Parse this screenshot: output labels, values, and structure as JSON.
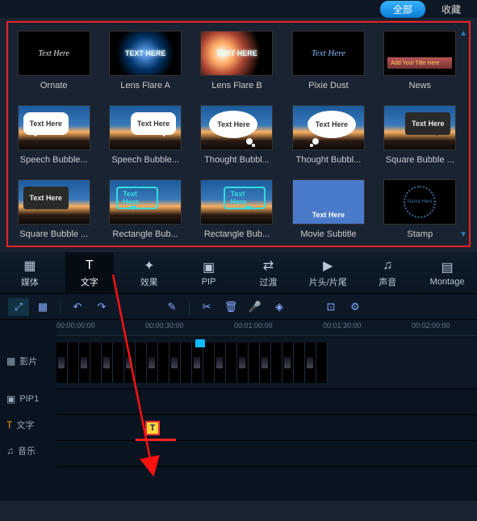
{
  "header": {
    "all_btn": "全部",
    "fav_link": "收藏"
  },
  "gallery": [
    {
      "label": "Ornate",
      "text": "Text Here",
      "cls": "t-dark t-ornate"
    },
    {
      "label": "Lens Flare A",
      "text": "TEXT HERE",
      "cls": "t-flare"
    },
    {
      "label": "Lens Flare B",
      "text": "TEXT HERE",
      "cls": "t-flare t-flareb"
    },
    {
      "label": "Pixie Dust",
      "text": "Text Here",
      "cls": "t-pixie"
    },
    {
      "label": "News",
      "text": "Add Your Title Here",
      "cls": "t-news",
      "news": true
    },
    {
      "label": "Speech Bubble...",
      "text": "Text Here",
      "cls": "t-sunset",
      "bubble": "b-spl"
    },
    {
      "label": "Speech Bubble...",
      "text": "Text Here",
      "cls": "t-sunset",
      "bubble": "b-spr"
    },
    {
      "label": "Thought Bubbl...",
      "text": "Text Here",
      "cls": "t-sunset",
      "bubble": "b-thl"
    },
    {
      "label": "Thought Bubbl...",
      "text": "Text Here",
      "cls": "t-sunset",
      "bubble": "b-thr"
    },
    {
      "label": "Square Bubble ...",
      "text": "Text Here",
      "cls": "t-sunset",
      "bubble": "b-sqr"
    },
    {
      "label": "Square Bubble ...",
      "text": "Text Here",
      "cls": "t-sunset",
      "bubble": "b-sql"
    },
    {
      "label": "Rectangle Bub...",
      "text": "Text Here",
      "cls": "t-sunset",
      "bubble": "b-rectl"
    },
    {
      "label": "Rectangle Bub...",
      "text": "Text Here",
      "cls": "t-sunset",
      "bubble": "b-rectr"
    },
    {
      "label": "Movie Subtitle",
      "text": "Text Here",
      "cls": "t-movsub",
      "movsub": true
    },
    {
      "label": "Stamp",
      "text": "Name Here",
      "cls": "t-stamp",
      "stamp": true
    }
  ],
  "tabs": [
    {
      "key": "media",
      "label": "媒体",
      "icon": "▦"
    },
    {
      "key": "text",
      "label": "文字",
      "icon": "T",
      "active": true
    },
    {
      "key": "effect",
      "label": "效果",
      "icon": "✦"
    },
    {
      "key": "pip",
      "label": "PIP",
      "icon": "▣"
    },
    {
      "key": "transition",
      "label": "过渡",
      "icon": "⇄"
    },
    {
      "key": "intro",
      "label": "片头/片尾",
      "icon": "▶"
    },
    {
      "key": "sound",
      "label": "声音",
      "icon": "♫"
    },
    {
      "key": "montage",
      "label": "Montage",
      "icon": "▤"
    }
  ],
  "toolbar": {
    "zoom": "⤢",
    "grid": "▦",
    "undo": "↶",
    "redo": "↷",
    "edit": "✎",
    "cut": "✂",
    "delete": "🗑",
    "mic": "🎤",
    "marker": "◈",
    "camera": "⊡",
    "gear": "⚙"
  },
  "timeline": {
    "ticks": [
      "00:00:00:00",
      "00:00:30:00",
      "00:01:00:00",
      "00:01:30:00",
      "00:02:00:00"
    ],
    "tracks": {
      "video": "影片",
      "pip": "PIP1",
      "text": "文字",
      "music": "音乐"
    },
    "text_clip": "T"
  }
}
